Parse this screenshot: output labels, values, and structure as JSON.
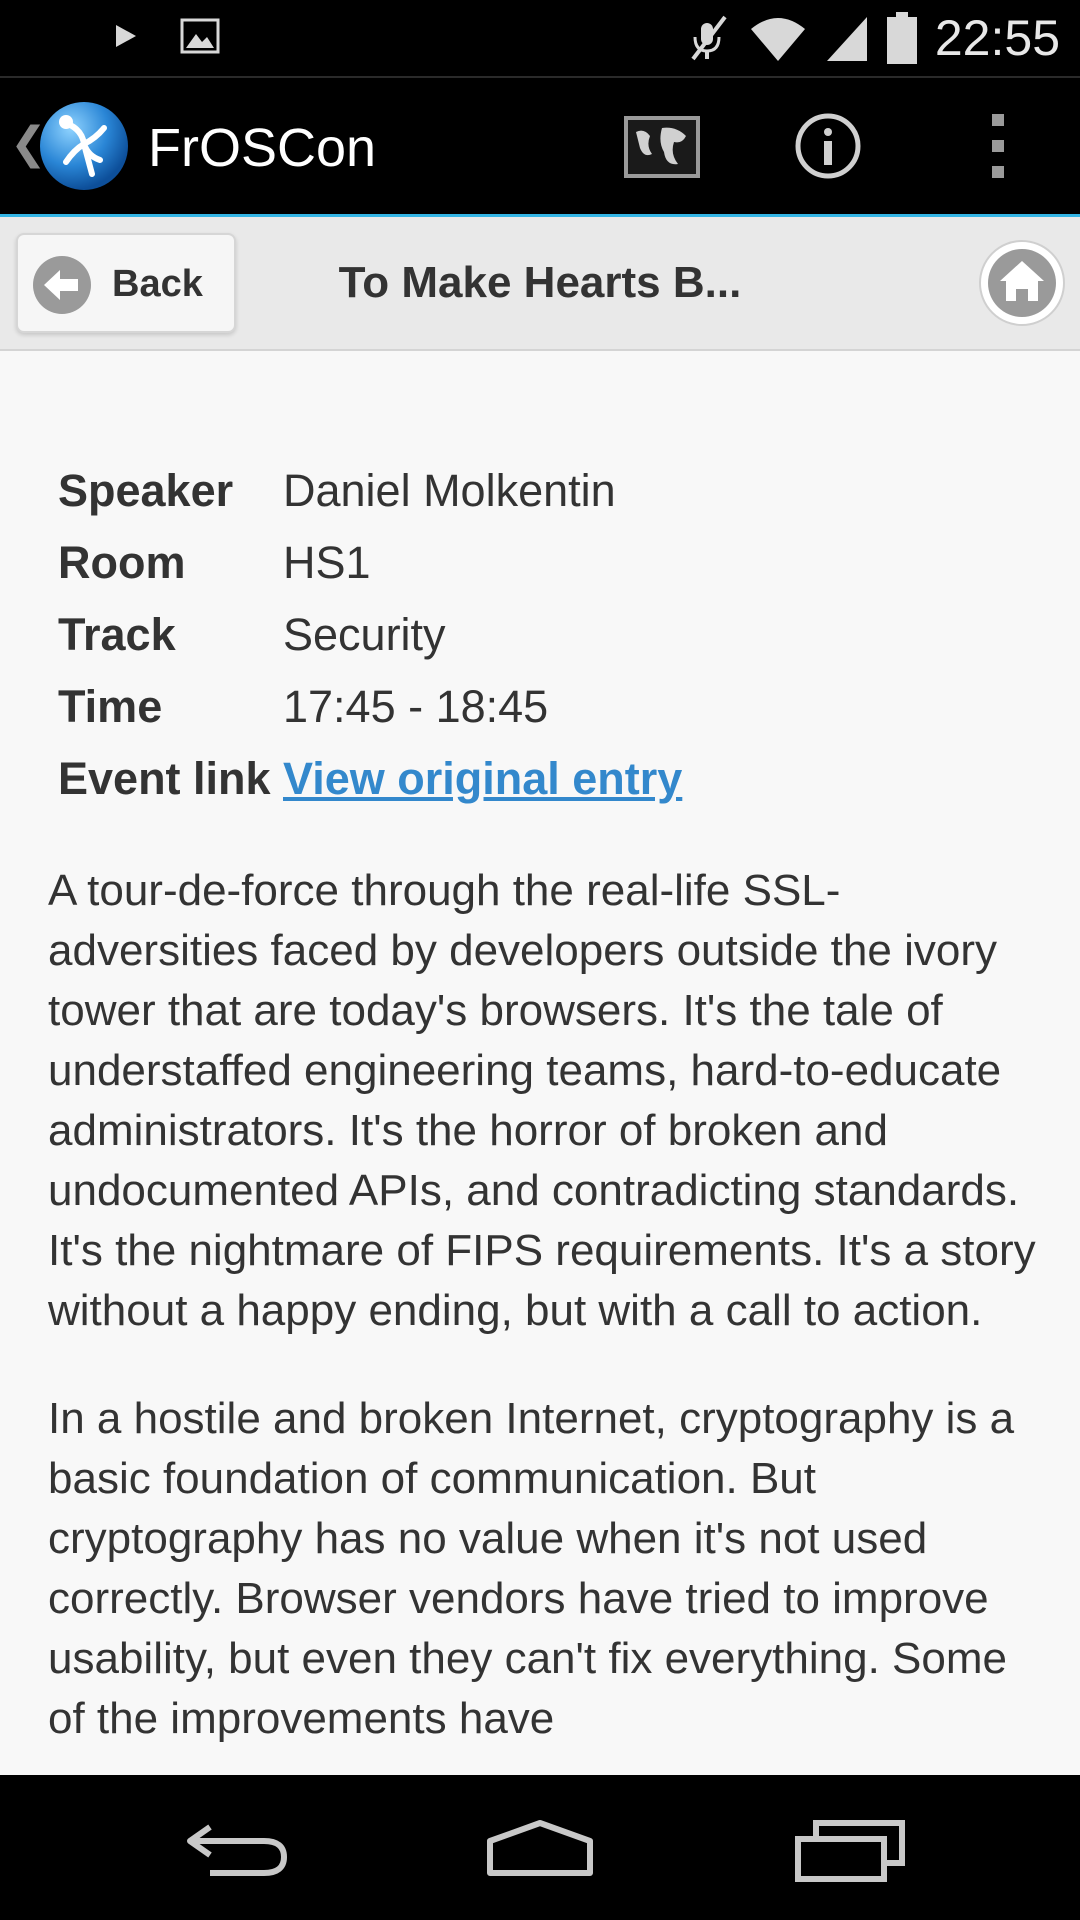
{
  "status_bar": {
    "time": "22:55",
    "icons": [
      "play-icon",
      "image-icon",
      "mute-icon",
      "wifi-icon",
      "signal-icon",
      "battery-icon"
    ]
  },
  "action_bar": {
    "title": "FrOSCon",
    "icons": [
      "map-icon",
      "info-icon",
      "overflow-menu-icon"
    ],
    "accent_color": "#33b5e5"
  },
  "header": {
    "back_label": "Back",
    "title": "To Make Hearts B..."
  },
  "details": [
    {
      "label": "Speaker",
      "value": "Daniel Molkentin"
    },
    {
      "label": "Room",
      "value": "HS1"
    },
    {
      "label": "Track",
      "value": "Security"
    },
    {
      "label": "Time",
      "value": "17:45 - 18:45"
    }
  ],
  "event_link": {
    "label": "Event link",
    "text": "View original entry",
    "color": "#3388cc"
  },
  "description": [
    "A tour-de-force through the real-life SSL-adversities faced by developers outside the ivory tower that are today's browsers. It's the tale of understaffed engineering teams, hard-to-educate administrators. It's the horror of broken and undocumented APIs, and contradicting standards. It's the nightmare of FIPS requirements. It's a story without a happy ending, but with a call to action.",
    "In a hostile and broken Internet, cryptography is a basic foundation of communication. But cryptography has no value when it's not used correctly. Browser vendors have tried to improve usability, but even they can't fix everything. Some of the improvements have"
  ],
  "nav_bar": {
    "buttons": [
      "back-nav-icon",
      "home-nav-icon",
      "recents-nav-icon"
    ]
  }
}
